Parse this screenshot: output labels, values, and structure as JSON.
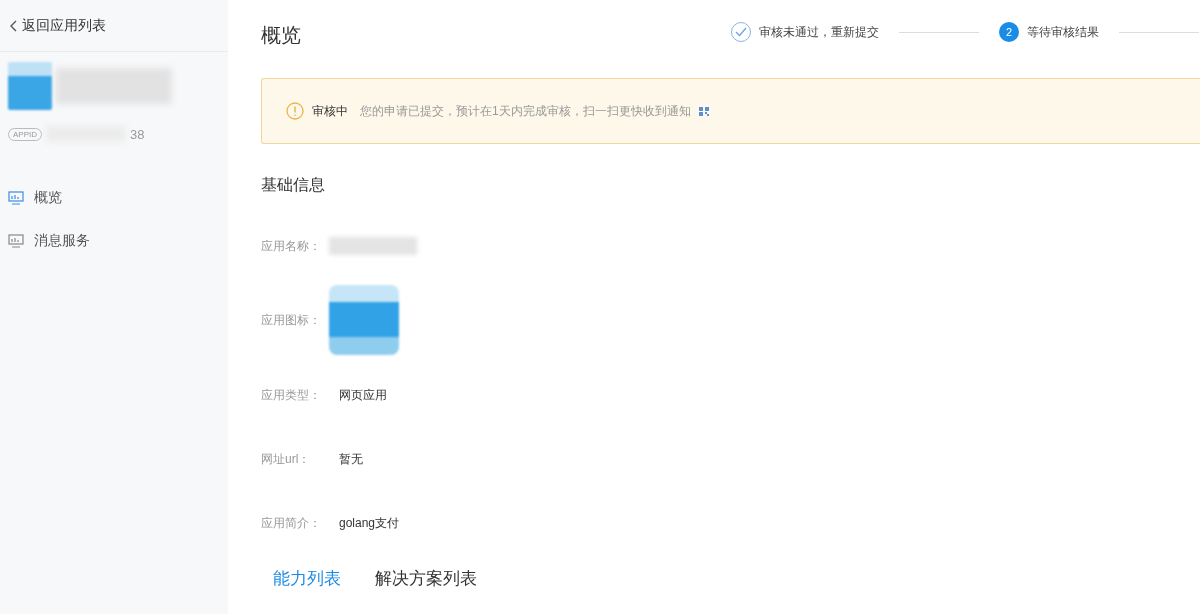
{
  "sidebar": {
    "back_link": "返回应用列表",
    "app": {
      "appid_badge": "APPID",
      "appid_suffix": "38"
    },
    "items": [
      {
        "label": "概览",
        "selected": true
      },
      {
        "label": "消息服务",
        "selected": false
      }
    ]
  },
  "page": {
    "title": "概览",
    "steps": [
      {
        "label": "审核未通过，重新提交",
        "kind": "check"
      },
      {
        "number": "2",
        "label": "等待审核结果",
        "kind": "number"
      }
    ],
    "alert": {
      "status": "审核中",
      "message": "您的申请已提交，预计在1天内完成审核，扫一扫更快收到通知"
    },
    "section_title": "基础信息",
    "fields": [
      {
        "label": "应用名称：",
        "kind": "blurred"
      },
      {
        "label": "应用图标：",
        "kind": "icon"
      },
      {
        "label": "应用类型：",
        "kind": "text",
        "value": "网页应用"
      },
      {
        "label": "网址url：",
        "kind": "text",
        "value": "暂无"
      },
      {
        "label": "应用简介：",
        "kind": "text",
        "value": "golang支付"
      }
    ],
    "tabs": [
      {
        "label": "能力列表",
        "selected": true
      },
      {
        "label": "解决方案列表",
        "selected": false
      }
    ]
  }
}
